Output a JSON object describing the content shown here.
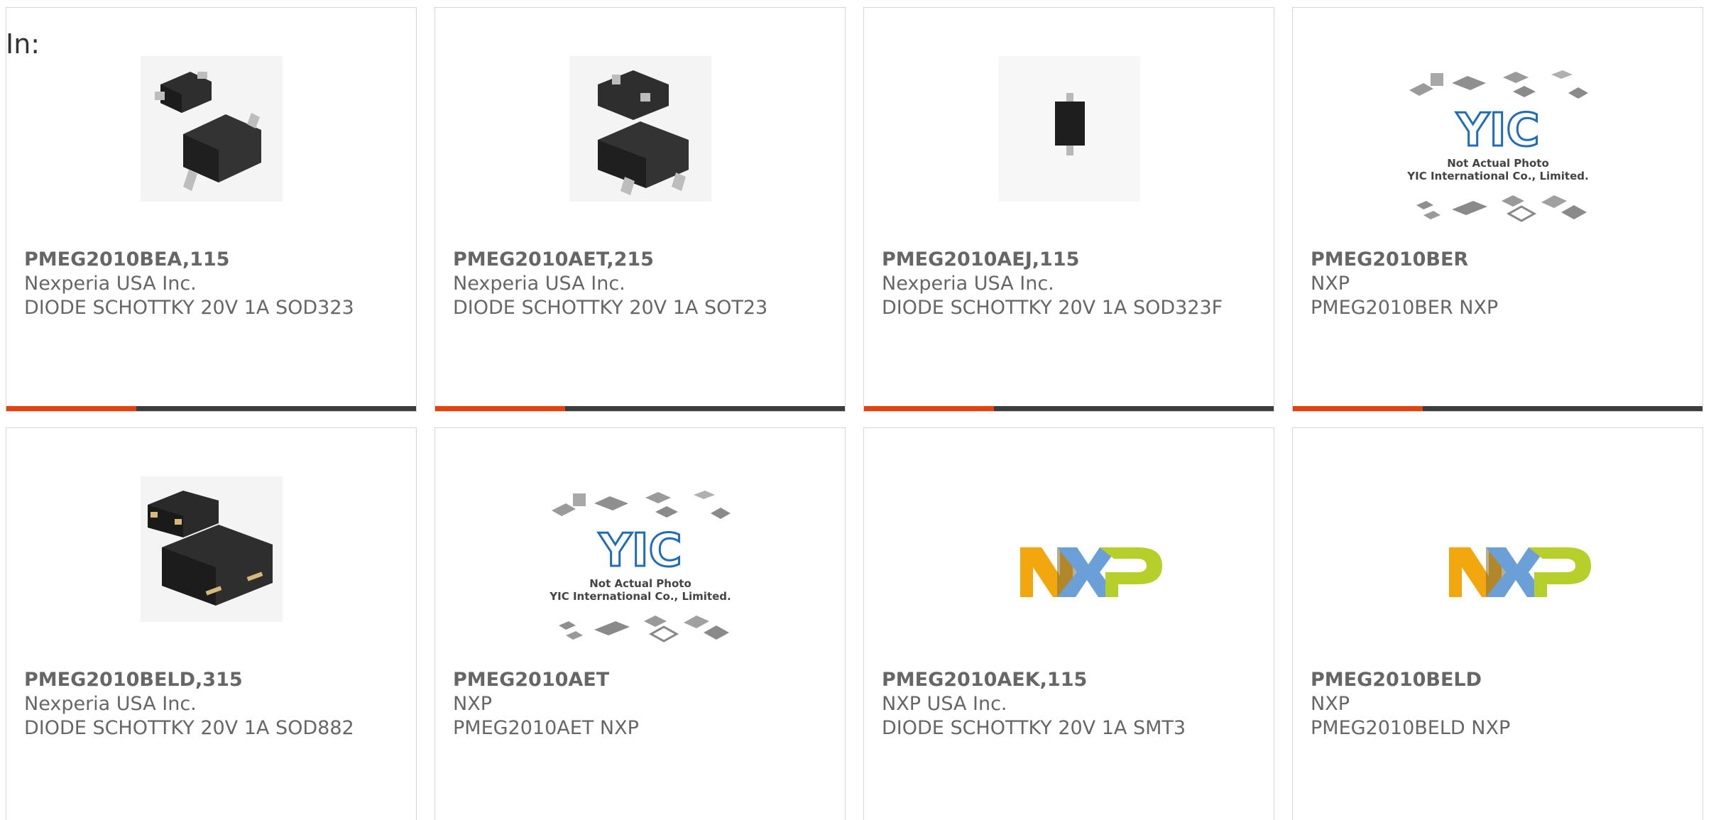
{
  "filter_label": "In:",
  "products": [
    {
      "part": "PMEG2010BEA,115",
      "manufacturer": "Nexperia USA Inc.",
      "description": "DIODE SCHOTTKY 20V 1A SOD323",
      "image": "sod323-package-photo"
    },
    {
      "part": "PMEG2010AET,215",
      "manufacturer": "Nexperia USA Inc.",
      "description": "DIODE SCHOTTKY 20V 1A SOT23",
      "image": "sot23-package-photo"
    },
    {
      "part": "PMEG2010AEJ,115",
      "manufacturer": "Nexperia USA Inc.",
      "description": "DIODE SCHOTTKY 20V 1A SOD323F",
      "image": "sod323f-package-photo"
    },
    {
      "part": "PMEG2010BER",
      "manufacturer": "NXP",
      "description": "PMEG2010BER NXP",
      "image": "yic-not-actual-photo",
      "placeholder_lines": [
        "Not Actual Photo",
        "YIC International Co., Limited."
      ]
    },
    {
      "part": "PMEG2010BELD,315",
      "manufacturer": "Nexperia USA Inc.",
      "description": "DIODE SCHOTTKY 20V 1A SOD882",
      "image": "sod882-package-photo"
    },
    {
      "part": "PMEG2010AET",
      "manufacturer": "NXP",
      "description": "PMEG2010AET NXP",
      "image": "yic-not-actual-photo",
      "placeholder_lines": [
        "Not Actual Photo",
        "YIC International Co., Limited."
      ]
    },
    {
      "part": "PMEG2010AEK,115",
      "manufacturer": "NXP USA Inc.",
      "description": "DIODE SCHOTTKY 20V 1A SMT3",
      "image": "nxp-logo"
    },
    {
      "part": "PMEG2010BELD",
      "manufacturer": "NXP",
      "description": "PMEG2010BELD NXP",
      "image": "nxp-logo"
    }
  ],
  "colors": {
    "accent": "#e8400c",
    "bar": "#3d3d3d",
    "text": "#666666",
    "border": "#d6d6d6"
  }
}
